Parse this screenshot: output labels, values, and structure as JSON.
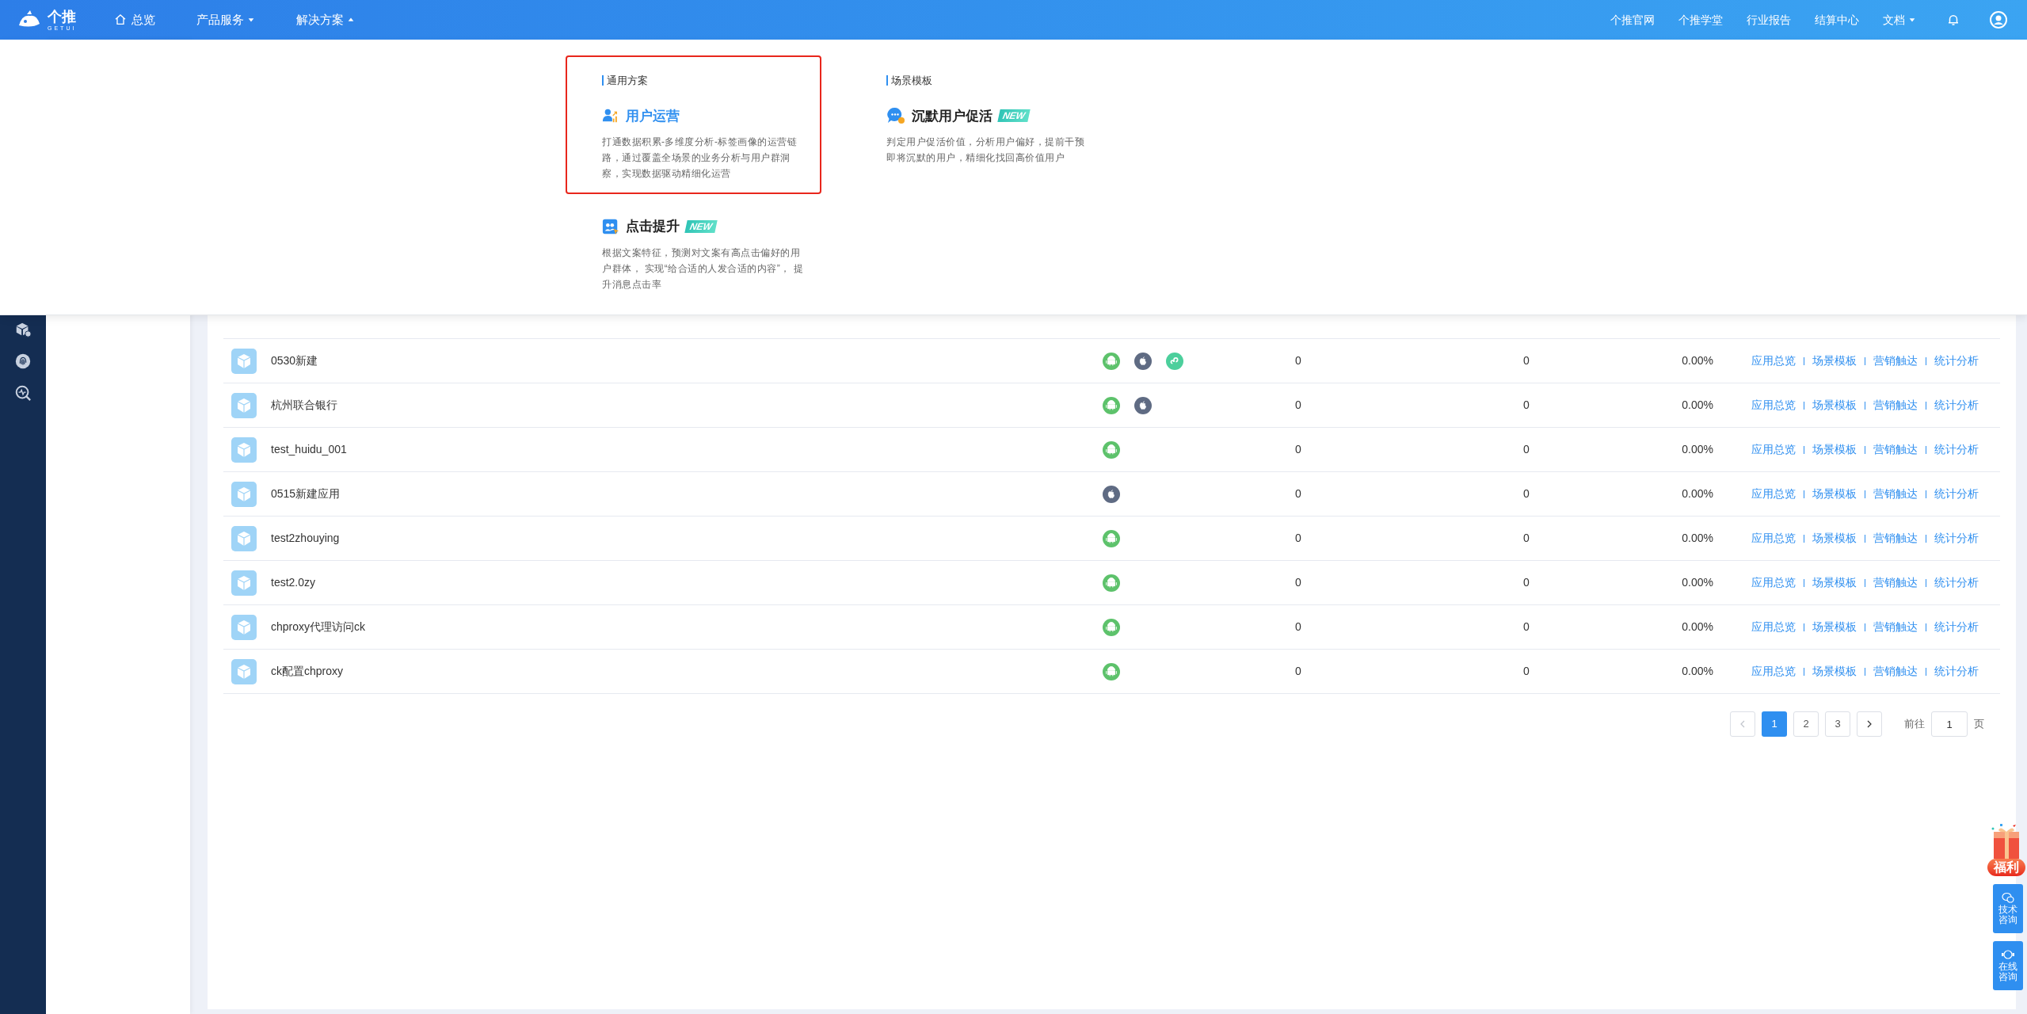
{
  "header": {
    "logo": {
      "text": "个推",
      "sub": "GETUI"
    },
    "nav": [
      {
        "kind": "home",
        "label": "总览"
      },
      {
        "kind": "menu",
        "label": "产品服务",
        "expanded": false
      },
      {
        "kind": "menu",
        "label": "解决方案",
        "expanded": true
      }
    ],
    "links": [
      {
        "kind": "link",
        "label": "个推官网"
      },
      {
        "kind": "link",
        "label": "个推学堂"
      },
      {
        "kind": "link",
        "label": "行业报告"
      },
      {
        "kind": "link",
        "label": "结算中心"
      },
      {
        "kind": "menu",
        "label": "文档",
        "expanded": false
      }
    ]
  },
  "dropdown": {
    "sections": [
      {
        "title": "通用方案",
        "items": [
          {
            "title": "用户运营",
            "desc": "打通数据积累-多维度分析-标签画像的运营链路，通过覆盖全场景的业务分析与用户群洞察，实现数据驱动精细化运营",
            "active": true,
            "highlighted": true
          },
          {
            "title": "点击提升",
            "badge": "NEW",
            "desc": "根据文案特征，预测对文案有高点击偏好的用户群体， 实现“给合适的人发合适的内容”， 提升消息点击率",
            "active": false,
            "highlighted": false
          }
        ]
      },
      {
        "title": "场景模板",
        "items": [
          {
            "title": "沉默用户促活",
            "badge": "NEW",
            "desc": "判定用户促活价值，分析用户偏好，提前干预即将沉默的用户，精细化找回高价值用户",
            "active": false,
            "highlighted": false
          }
        ]
      }
    ]
  },
  "table": {
    "rows": [
      {
        "name": "0530新建",
        "platforms": [
          {
            "kind": "android"
          },
          {
            "kind": "ios"
          },
          {
            "kind": "mini"
          }
        ],
        "column_3": "0",
        "column_4": "0",
        "column_5": "0.00%",
        "actions": [
          "应用总览",
          "场景模板",
          "营销触达",
          "统计分析"
        ]
      },
      {
        "name": "杭州联合银行",
        "platforms": [
          {
            "kind": "android"
          },
          {
            "kind": "ios"
          }
        ],
        "column_3": "0",
        "column_4": "0",
        "column_5": "0.00%",
        "actions": [
          "应用总览",
          "场景模板",
          "营销触达",
          "统计分析"
        ]
      },
      {
        "name": "test_huidu_001",
        "platforms": [
          {
            "kind": "android"
          }
        ],
        "column_3": "0",
        "column_4": "0",
        "column_5": "0.00%",
        "actions": [
          "应用总览",
          "场景模板",
          "营销触达",
          "统计分析"
        ]
      },
      {
        "name": "0515新建应用",
        "platforms": [
          {
            "kind": "ios"
          }
        ],
        "column_3": "0",
        "column_4": "0",
        "column_5": "0.00%",
        "actions": [
          "应用总览",
          "场景模板",
          "营销触达",
          "统计分析"
        ]
      },
      {
        "name": "test2zhouying",
        "platforms": [
          {
            "kind": "android"
          }
        ],
        "column_3": "0",
        "column_4": "0",
        "column_5": "0.00%",
        "actions": [
          "应用总览",
          "场景模板",
          "营销触达",
          "统计分析"
        ]
      },
      {
        "name": "test2.0zy",
        "platforms": [
          {
            "kind": "android"
          }
        ],
        "column_3": "0",
        "column_4": "0",
        "column_5": "0.00%",
        "actions": [
          "应用总览",
          "场景模板",
          "营销触达",
          "统计分析"
        ]
      },
      {
        "name": "chproxy代理访问ck",
        "platforms": [
          {
            "kind": "android"
          }
        ],
        "column_3": "0",
        "column_4": "0",
        "column_5": "0.00%",
        "actions": [
          "应用总览",
          "场景模板",
          "营销触达",
          "统计分析"
        ]
      },
      {
        "name": "ck配置chproxy",
        "platforms": [
          {
            "kind": "android"
          }
        ],
        "column_3": "0",
        "column_4": "0",
        "column_5": "0.00%",
        "actions": [
          "应用总览",
          "场景模板",
          "营销触达",
          "统计分析"
        ]
      }
    ]
  },
  "pagination": {
    "pages": [
      {
        "label": "1",
        "selected": true
      },
      {
        "label": "2",
        "selected": false
      },
      {
        "label": "3",
        "selected": false
      }
    ],
    "goto_label": "前往",
    "goto_value": "1",
    "goto_suffix": "页"
  },
  "side_widgets": {
    "gift": "福利",
    "buttons": [
      {
        "label": "技术咨询"
      },
      {
        "label": "在线咨询"
      }
    ]
  }
}
